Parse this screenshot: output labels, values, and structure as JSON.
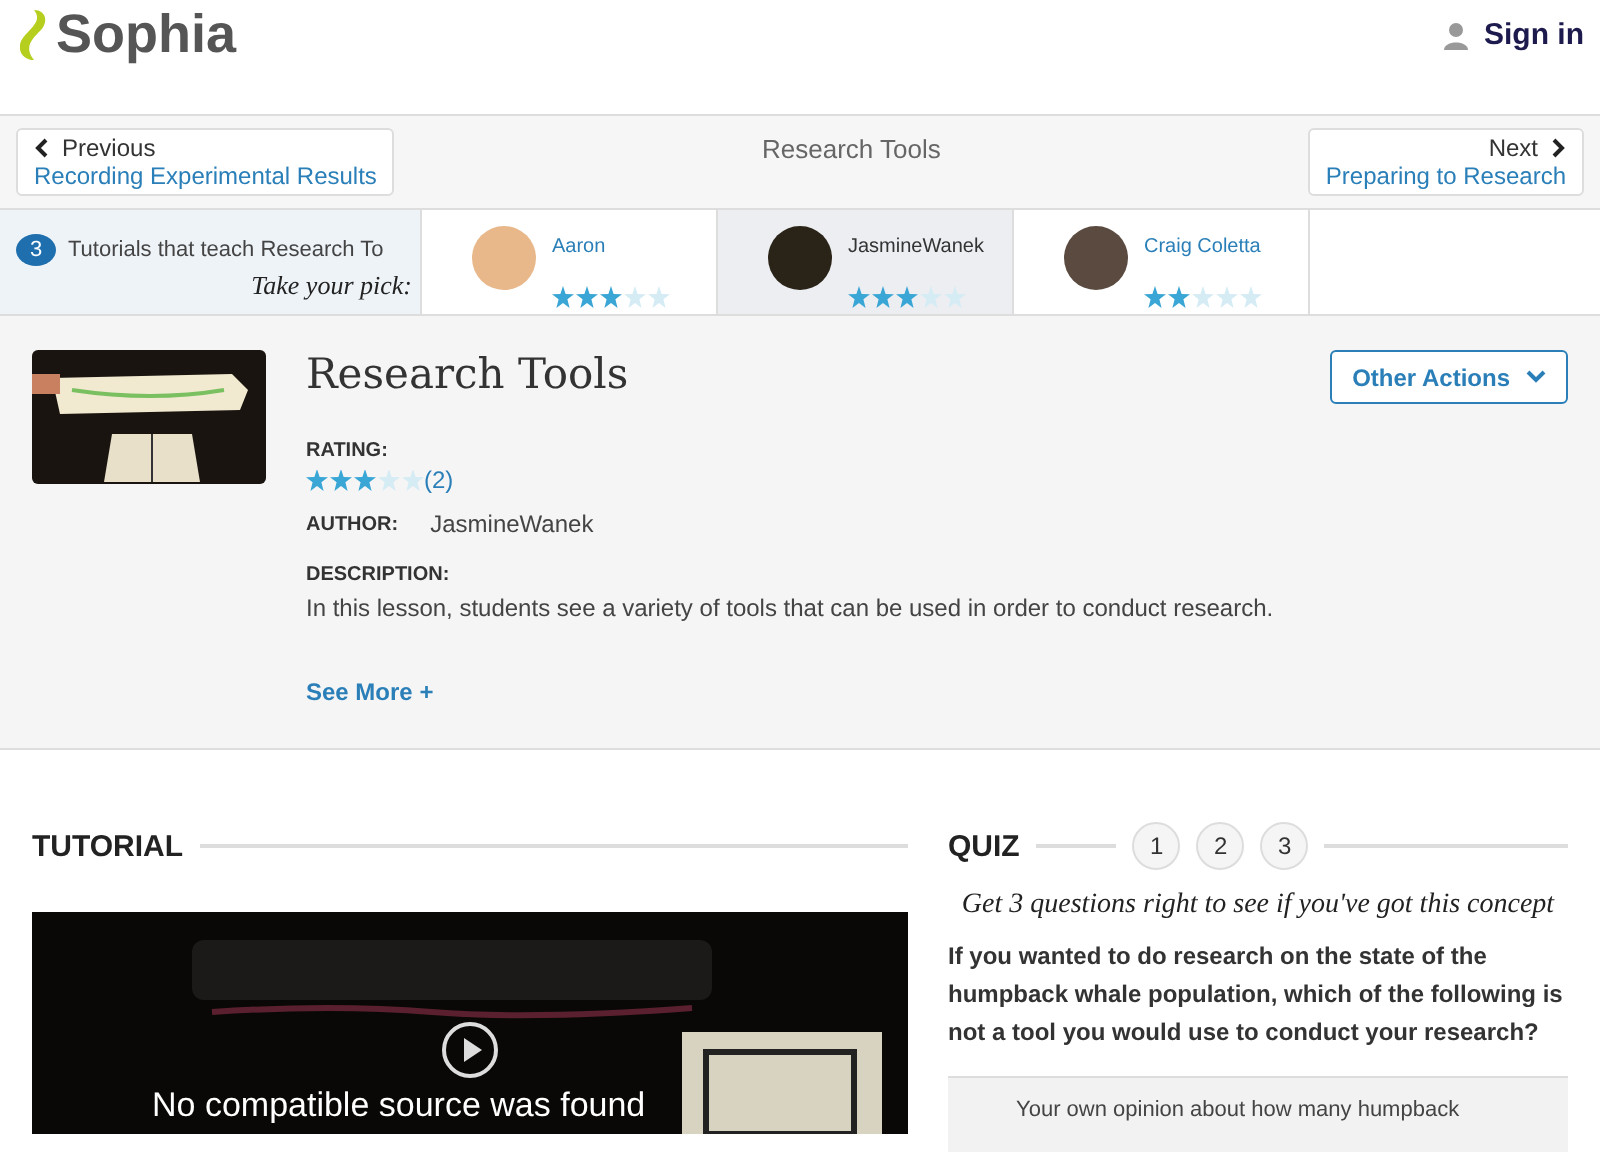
{
  "header": {
    "logo": "Sophia",
    "sign_in": "Sign in"
  },
  "nav": {
    "previous": {
      "label": "Previous",
      "title": "Recording Experimental Results"
    },
    "current": "Research Tools",
    "next": {
      "label": "Next",
      "title": "Preparing to Research"
    }
  },
  "tutorials": {
    "count": "3",
    "label": "Tutorials that teach Research To",
    "pick": "Take your pick:",
    "authors": [
      {
        "name": "Aaron",
        "stars": 3,
        "selected": false
      },
      {
        "name": "JasmineWanek",
        "stars": 3,
        "selected": true
      },
      {
        "name": "Craig Coletta",
        "stars": 2,
        "selected": false
      }
    ]
  },
  "detail": {
    "title": "Research Tools",
    "actions": "Other Actions",
    "rating_label": "RATING:",
    "stars": 3,
    "rating_count": "(2)",
    "author_label": "AUTHOR:",
    "author": "JasmineWanek",
    "description_label": "DESCRIPTION:",
    "description": "In this lesson, students see a variety of tools that can be used in order to conduct research.",
    "see_more": "See More +"
  },
  "tutorial": {
    "heading": "TUTORIAL",
    "video_message": "No compatible source was found"
  },
  "quiz": {
    "heading": "QUIZ",
    "steps": [
      {
        "label": "1",
        "selected": false
      },
      {
        "label": "2",
        "selected": false
      },
      {
        "label": "3",
        "selected": false
      }
    ],
    "hint": "Get 3 questions right to see if you've got this concept",
    "question": "If you wanted to do research on the state of the humpback whale population, which of the following is not a tool you would use to  conduct your research?",
    "answers": [
      "Your own opinion about how many humpback"
    ]
  }
}
